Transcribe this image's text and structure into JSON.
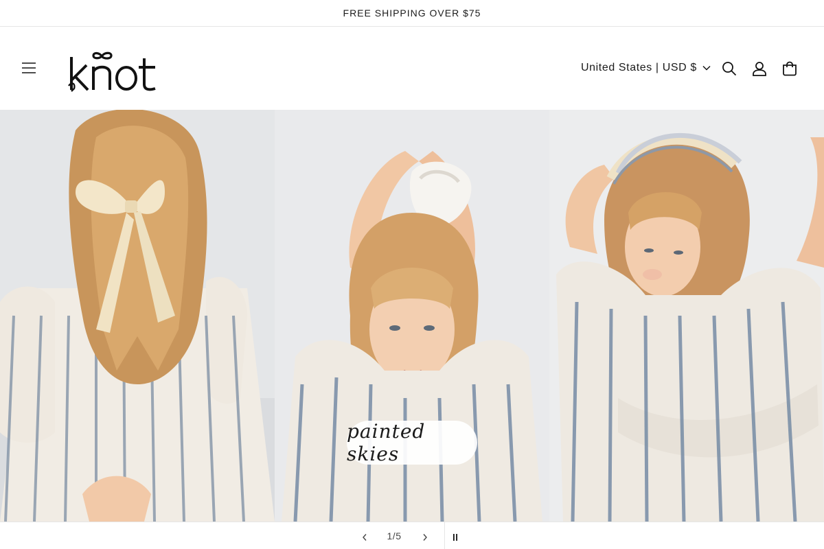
{
  "announcement": {
    "text": "FREE SHIPPING OVER $75"
  },
  "header": {
    "logo_text": "knot",
    "country_selector": "United States | USD $",
    "icons": {
      "menu": "menu-icon",
      "search": "search-icon",
      "account": "account-icon",
      "cart": "cart-icon",
      "country_chevron": "chevron-down-icon"
    }
  },
  "slideshow": {
    "caption": "painted skies",
    "counter": "1/5",
    "icons": {
      "previous": "chevron-left-icon",
      "next": "chevron-right-icon",
      "pause": "pause-icon"
    }
  },
  "colors": {
    "background": "#ffffff",
    "text": "#121212",
    "border": "#e6e6e6"
  }
}
